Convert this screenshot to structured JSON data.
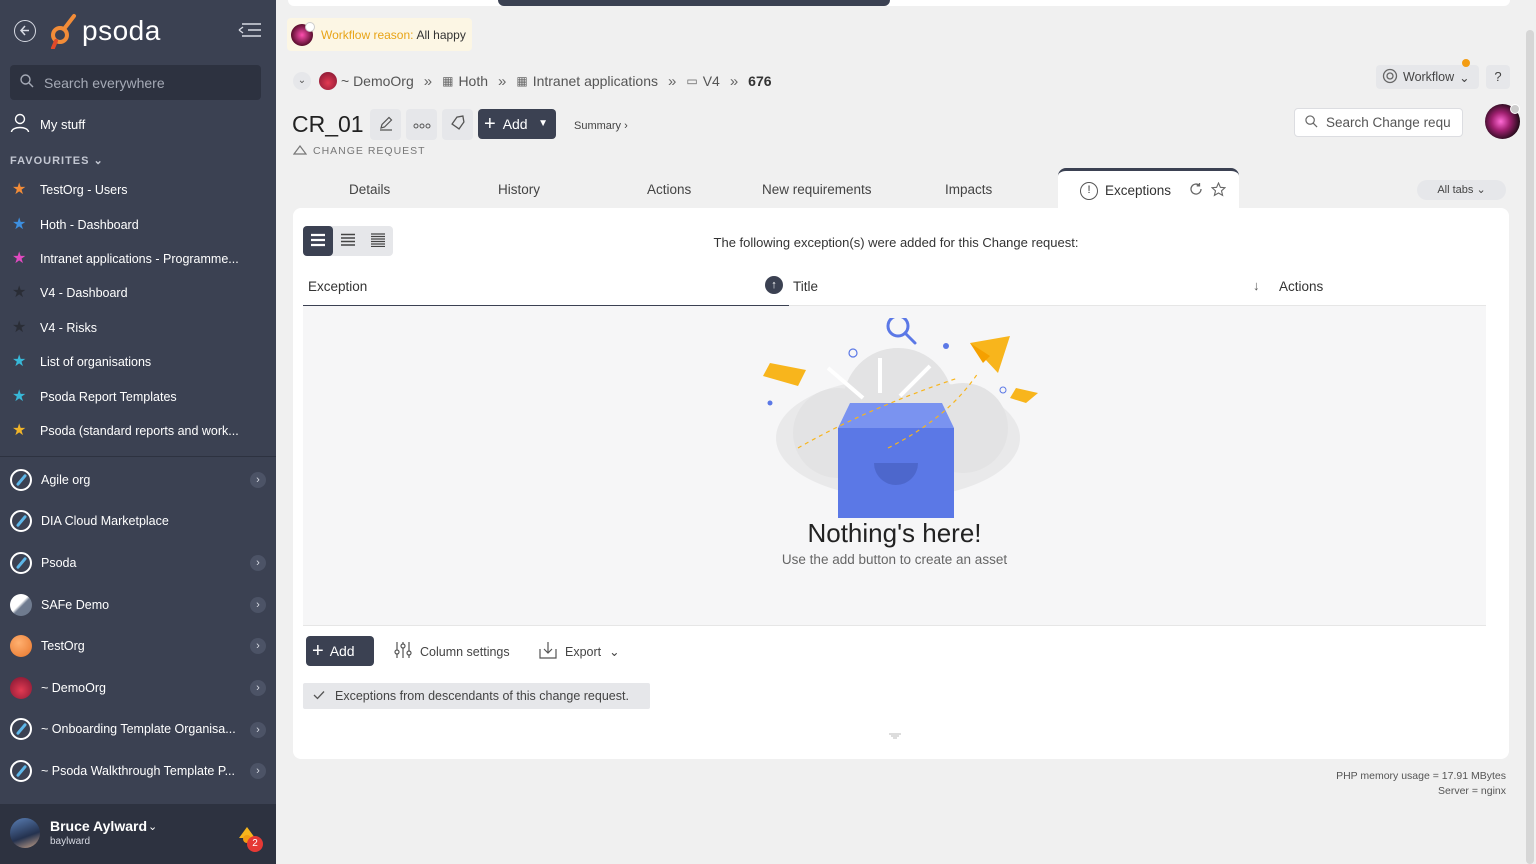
{
  "sidebar": {
    "logo_text": "psoda",
    "search_placeholder": "Search everywhere",
    "my_stuff": "My stuff",
    "favourites_label": "FAVOURITES",
    "favourites": [
      {
        "label": "TestOrg - Users",
        "star_color": "#f28c38"
      },
      {
        "label": "Hoth - Dashboard",
        "star_color": "#3d8fe0"
      },
      {
        "label": "Intranet applications - Programme...",
        "star_color": "#e04ac0"
      },
      {
        "label": "V4 - Dashboard",
        "star_color": "#2a2d36"
      },
      {
        "label": "V4 - Risks",
        "star_color": "#2a2d36"
      },
      {
        "label": "List of organisations",
        "star_color": "#38b8d8"
      },
      {
        "label": "Psoda Report Templates",
        "star_color": "#38b8d8"
      },
      {
        "label": "Psoda (standard reports and work...",
        "star_color": "#f0b429"
      }
    ],
    "orgs": [
      {
        "label": "Agile org",
        "icon": "compass-icon",
        "chevron": true
      },
      {
        "label": "DIA Cloud Marketplace",
        "icon": "compass-icon",
        "chevron": false
      },
      {
        "label": "Psoda",
        "icon": "compass-icon",
        "chevron": true
      },
      {
        "label": "SAFe Demo",
        "icon": "safe-icon",
        "chevron": true
      },
      {
        "label": "TestOrg",
        "icon": "testorg-icon",
        "chevron": true
      },
      {
        "label": "~ DemoOrg",
        "icon": "demoorg-icon",
        "chevron": true
      },
      {
        "label": "~ Onboarding Template Organisa...",
        "icon": "compass-icon",
        "chevron": true
      },
      {
        "label": "~ Psoda Walkthrough Template P...",
        "icon": "compass-icon",
        "chevron": true
      }
    ],
    "user": {
      "name": "Bruce Aylward",
      "handle": "baylward",
      "notifications": "2"
    }
  },
  "workflow_reason": {
    "label": "Workflow reason:",
    "value": "All happy"
  },
  "breadcrumb": [
    {
      "label": "~ DemoOrg"
    },
    {
      "label": "Hoth"
    },
    {
      "label": "Intranet applications"
    },
    {
      "label": "V4"
    },
    {
      "label": "676"
    }
  ],
  "header": {
    "title": "CR_01",
    "type_label": "CHANGE REQUEST",
    "add_label": "Add",
    "summary_label": "Summary ›",
    "workflow_label": "Workflow",
    "help_label": "?",
    "search_placeholder": "Search Change requ"
  },
  "tabs": [
    "Details",
    "History",
    "Actions",
    "New requirements",
    "Impacts"
  ],
  "active_tab": "Exceptions",
  "all_tabs_label": "All tabs",
  "panel": {
    "message": "The following exception(s) were added for this Change request:",
    "columns": [
      "Exception",
      "Title",
      "Actions"
    ],
    "empty_title": "Nothing's here!",
    "empty_subtitle": "Use the add button to create an asset",
    "add_label": "Add",
    "column_settings_label": "Column settings",
    "export_label": "Export",
    "descendants_label": "Exceptions from descendants of this change request."
  },
  "footer": {
    "memory": "PHP memory usage = 17.91 MBytes",
    "server": "Server = nginx"
  },
  "colors": {
    "sidebar": "#3b4152",
    "accent_orange": "#f39c12",
    "illustration_blue": "#5b78e6",
    "illustration_yellow": "#f8b51c"
  }
}
